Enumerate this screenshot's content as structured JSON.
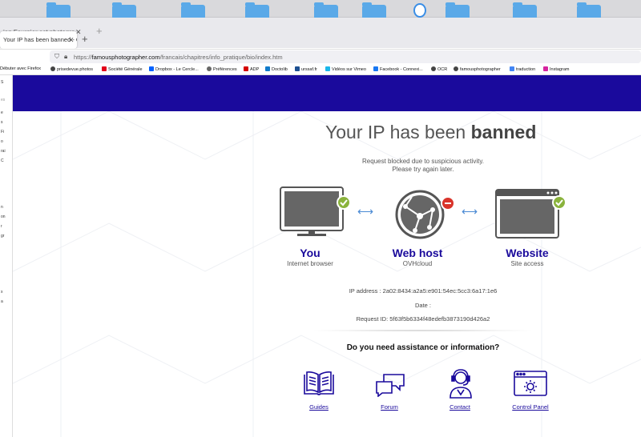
{
  "browser": {
    "tabs": [
      {
        "label": "ian Fournier est photographe",
        "active": false
      },
      {
        "label": "Your IP has been banned - OVH",
        "active": true
      }
    ],
    "url": {
      "prefix": "https://",
      "host": "famousphotographer.com",
      "path": "/francais/chapitres/info_pratique/bio/index.htm"
    },
    "bookmarks": [
      {
        "label": "Débuter avec Firefox",
        "color": "#e66000"
      },
      {
        "label": "prisedevue.photos",
        "color": "#444444"
      },
      {
        "label": "Société Générale",
        "color": "#e2001a"
      },
      {
        "label": "Dropbox - Le Cercle...",
        "color": "#0061ff"
      },
      {
        "label": "Préférences",
        "color": "#666666"
      },
      {
        "label": "ADP",
        "color": "#d40000"
      },
      {
        "label": "Doctolib",
        "color": "#107aca"
      },
      {
        "label": "urssaf.fr",
        "color": "#1d4f91"
      },
      {
        "label": "Vidéos sur Vimeo",
        "color": "#1ab7ea"
      },
      {
        "label": "Facebook - Connexi...",
        "color": "#1877f2"
      },
      {
        "label": "OCR",
        "color": "#444444"
      },
      {
        "label": "famousphotographer",
        "color": "#444444"
      },
      {
        "label": "traduction",
        "color": "#4285f4"
      },
      {
        "label": "Instagram",
        "color": "#d6249f"
      }
    ],
    "sidebar_fragments": [
      "S",
      "es",
      "e",
      "s",
      "Fi",
      "o",
      "rai",
      "C",
      "n",
      "on",
      "r",
      "gr",
      "x",
      "a"
    ]
  },
  "page": {
    "title_prefix": "Your IP has been ",
    "title_bold": "banned",
    "sub_line1": "Request blocked due to suspicious activity.",
    "sub_line2": "Please try again later.",
    "nodes": [
      {
        "title": "You",
        "subtitle": "Internet browser",
        "status": "ok"
      },
      {
        "title": "Web host",
        "subtitle": "OVHcloud",
        "status": "blocked"
      },
      {
        "title": "Website",
        "subtitle": "Site access",
        "status": "ok"
      }
    ],
    "ip_label": "IP address : 2a02:8434:a2a5:e901:54ec:5cc3:6a17:1e6",
    "date_label": "Date :",
    "request_label": "Request ID: 5f63f5b6334f48edefb3873190d426a2",
    "assist_heading": "Do you need assistance or information?",
    "links": [
      {
        "label": "Guides",
        "icon": "book-icon"
      },
      {
        "label": "Forum",
        "icon": "chat-bubbles-icon"
      },
      {
        "label": "Contact",
        "icon": "support-agent-icon"
      },
      {
        "label": "Control Panel",
        "icon": "control-panel-icon"
      }
    ],
    "colors": {
      "brand": "#1a0a9c",
      "ok": "#8ab33c",
      "blocked": "#d9342b",
      "arrow": "#4a8ad4"
    }
  }
}
